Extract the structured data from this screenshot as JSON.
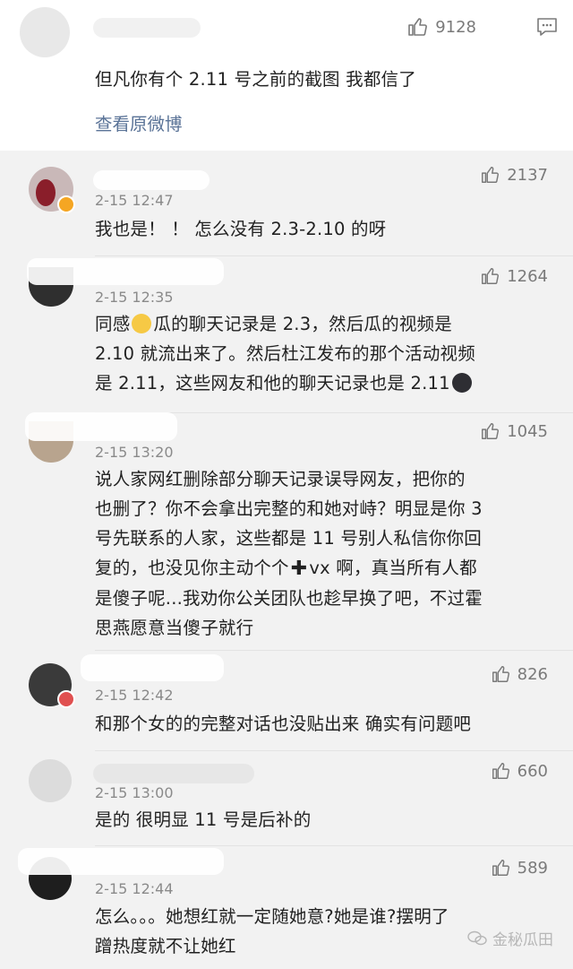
{
  "top": {
    "likes": "9128",
    "text": "但凡你有个 2.11 号之前的截图 我都信了",
    "view_original": "查看原微博"
  },
  "comments": [
    {
      "time": "2-15 12:47",
      "likes": "2137",
      "text": "我也是！ ！ 怎么没有 2.3-2.10 的呀"
    },
    {
      "time": "2-15 12:35",
      "likes": "1264",
      "line1_a": "同感",
      "line1_b": "瓜的聊天记录是 2.3，然后瓜的视频是",
      "line2": "2.10 就流出来了。然后杜江发布的那个活动视频",
      "line3": "是 2.11，这些网友和他的聊天记录也是 2.11"
    },
    {
      "time": "2-15 13:20",
      "likes": "1045",
      "line1": "说人家网红删除部分聊天记录误导网友，把你的",
      "line2": "也删了？你不会拿出完整的和她对峙？明显是你 3",
      "line3": "号先联系的人家，这些都是 11 号别人私信你你回",
      "line4_a": "复的，也没见你主动个个",
      "line4_b": "vx 啊，真当所有人都",
      "line5": "是傻子呢...我劝你公关团队也趁早换了吧，不过霍",
      "line6": "思燕愿意当傻子就行"
    },
    {
      "time": "2-15 12:42",
      "likes": "826",
      "text": "和那个女的的完整对话也没贴出来 确实有问题吧"
    },
    {
      "time": "2-15 13:00",
      "likes": "660",
      "text": "是的 很明显 11 号是后补的"
    },
    {
      "time": "2-15 12:44",
      "likes": "589",
      "line1": "怎么。。。她想红就一定随她意?她是谁?摆明了",
      "line2": "蹭热度就不让她红"
    }
  ],
  "watermark": "金秘瓜田",
  "colors": {
    "link": "#5a7397",
    "meta": "#8a8a8a",
    "background": "#f2f2f2",
    "verified": "#f5a623"
  }
}
